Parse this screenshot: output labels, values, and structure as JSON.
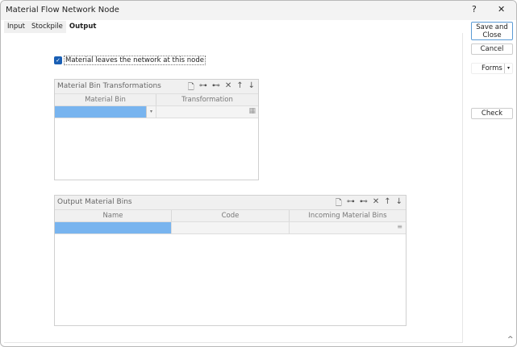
{
  "window": {
    "title": "Material Flow Network Node",
    "help": "?",
    "close": "✕"
  },
  "tabs": [
    {
      "label": "Input"
    },
    {
      "label": "Stockpile"
    },
    {
      "label": "Output"
    }
  ],
  "checkbox": {
    "label": "Material leaves the network at this node",
    "checked": true
  },
  "panel1": {
    "title": "Material Bin Transformations",
    "columns": [
      "Material Bin",
      "Transformation"
    ]
  },
  "panel2": {
    "title": "Output Material Bins",
    "columns": [
      "Name",
      "Code",
      "Incoming Material Bins"
    ]
  },
  "buttons": {
    "save": "Save and Close",
    "cancel": "Cancel",
    "forms": "Forms",
    "check": "Check"
  },
  "colors": {
    "selected": "#78b4ef",
    "accent": "#1a5fb4"
  }
}
